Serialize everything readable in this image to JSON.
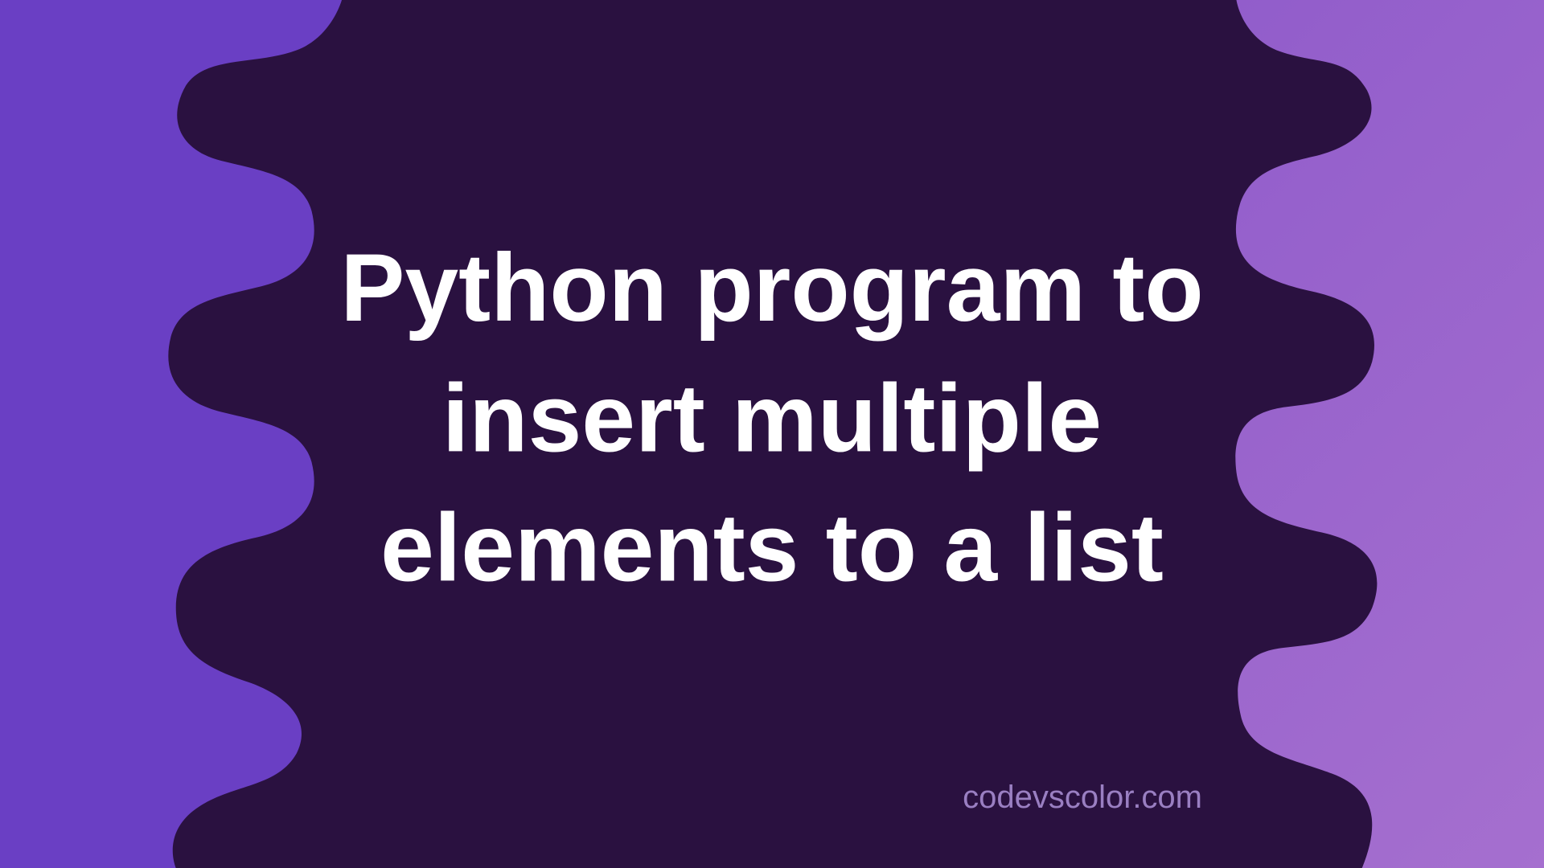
{
  "title": "Python program to insert multiple elements to a list",
  "footer": "codevscolor.com",
  "colors": {
    "blob": "#2a1140",
    "left_bg": "#6a3fc4",
    "right_bg_start": "#8a56c9",
    "right_bg_end": "#a56fcf",
    "title_text": "#ffffff",
    "footer_text": "#9a7fc2"
  }
}
